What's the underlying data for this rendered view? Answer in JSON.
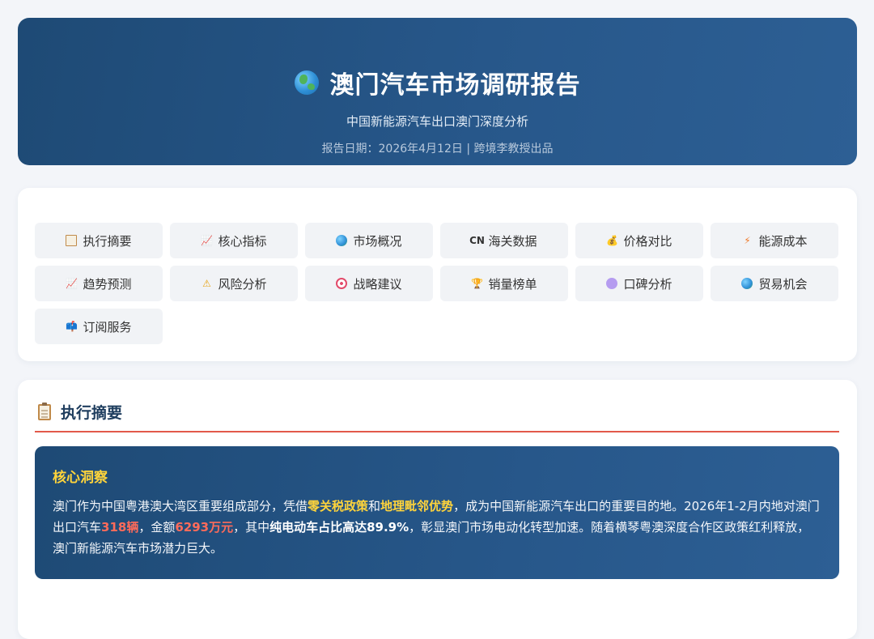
{
  "header": {
    "title": "澳门汽车市场调研报告",
    "subtitle": "中国新能源汽车出口澳门深度分析",
    "date_line": "报告日期：2026年4月12日 | 跨境李教授出品"
  },
  "nav": {
    "items": [
      {
        "label": "执行摘要",
        "icon": "clipboard-icon"
      },
      {
        "label": "核心指标",
        "icon": "chart-icon"
      },
      {
        "label": "市场概况",
        "icon": "globe-icon"
      },
      {
        "label": "海关数据",
        "icon": "cn-flag-icon",
        "icon_text": "CN"
      },
      {
        "label": "价格对比",
        "icon": "money-bag-icon"
      },
      {
        "label": "能源成本",
        "icon": "lightning-icon"
      },
      {
        "label": "趋势预测",
        "icon": "chart-icon"
      },
      {
        "label": "风险分析",
        "icon": "warning-icon"
      },
      {
        "label": "战略建议",
        "icon": "target-icon"
      },
      {
        "label": "销量榜单",
        "icon": "trophy-icon"
      },
      {
        "label": "口碑分析",
        "icon": "speech-bubble-icon"
      },
      {
        "label": "贸易机会",
        "icon": "globe-icon"
      },
      {
        "label": "订阅服务",
        "icon": "mailbox-icon"
      }
    ]
  },
  "summary": {
    "title": "执行摘要",
    "insight_title": "核心洞察",
    "p1": "澳门作为中国粤港澳大湾区重要组成部分，凭借",
    "h1": "零关税政策",
    "p2": "和",
    "h2": "地理毗邻优势",
    "p3": "，成为中国新能源汽车出口的重要目的地。2026年1-2月内地对澳门出口汽车",
    "h3": "318辆",
    "p4": "，金额",
    "h4": "6293万元",
    "p5": "，其中",
    "h5": "纯电动车占比高达89.9%",
    "p6": "，彰显澳门市场电动化转型加速。随着横琴粤澳深度合作区政策红利释放，澳门新能源汽车市场潜力巨大。"
  },
  "colors": {
    "header_bg": "#1e4a75",
    "highlight_yellow": "#ffd43b",
    "highlight_red": "#ff6b5a",
    "divider_red": "#e25a4a"
  }
}
